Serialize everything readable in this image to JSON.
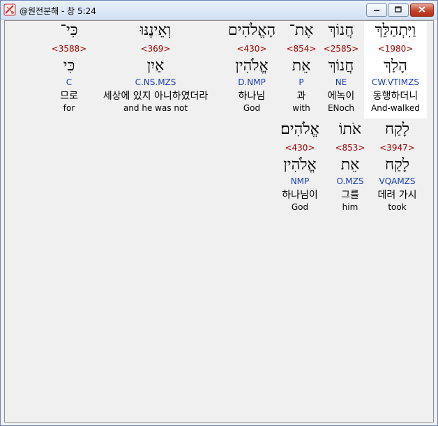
{
  "window": {
    "title": "@원전분해 - 창 5:24",
    "min_symbol": "−",
    "max_symbol": "□",
    "close_symbol": "✕"
  },
  "colors": {
    "strong": "#a00000",
    "morph": "#1a3db0",
    "highlight_bg": "#ffffff",
    "client_bg": "#f0f0f0"
  },
  "line1": [
    {
      "hebrew": "וַיִּתְהַלֵּךְ",
      "strong": "<1980>",
      "lemma": "הָלַךְ",
      "morph": "CW.VTIMZS",
      "korean": "동행하더니",
      "english": "And-walked",
      "selected": true
    },
    {
      "hebrew": "חֲנוֹךְ",
      "strong": "<2585>",
      "lemma": "חֲנוֹךְ",
      "morph": "NE",
      "korean": "에녹이",
      "english": "ENoch",
      "selected": false
    },
    {
      "hebrew": "אֶת־",
      "strong": "<854>",
      "lemma": "אֵת",
      "morph": "P",
      "korean": "과",
      "english": "with",
      "selected": false
    },
    {
      "hebrew": "הָאֱלֹהִים",
      "strong": "<430>",
      "lemma": "אֱלֹהִין",
      "morph": "D.NMP",
      "korean": "하나님",
      "english": "God",
      "selected": false
    },
    {
      "hebrew": "וְאֵינֶנּוּ",
      "strong": "<369>",
      "lemma": "אַיִן",
      "morph": "C.NS.MZS",
      "korean": "세상에 있지 아니하였더라",
      "english": "and he was not",
      "selected": false
    },
    {
      "hebrew": "כִּי־",
      "strong": "<3588>",
      "lemma": "כִּי",
      "morph": "C",
      "korean": "므로",
      "english": "for",
      "selected": false
    }
  ],
  "line2": [
    {
      "hebrew": "לָקַח",
      "strong": "<3947>",
      "lemma": "לָקַח",
      "morph": "VQAMZS",
      "korean": "데려 가시",
      "english": "took"
    },
    {
      "hebrew": "אֹתוֹ",
      "strong": "<853>",
      "lemma": "אֵת",
      "morph": "O.MZS",
      "korean": "그를",
      "english": "him"
    },
    {
      "hebrew": "אֱלֹהִים׃",
      "strong": "<430>",
      "lemma": "אֱלֹהִין",
      "morph": "NMP",
      "korean": "하나님이",
      "english": "God"
    }
  ]
}
